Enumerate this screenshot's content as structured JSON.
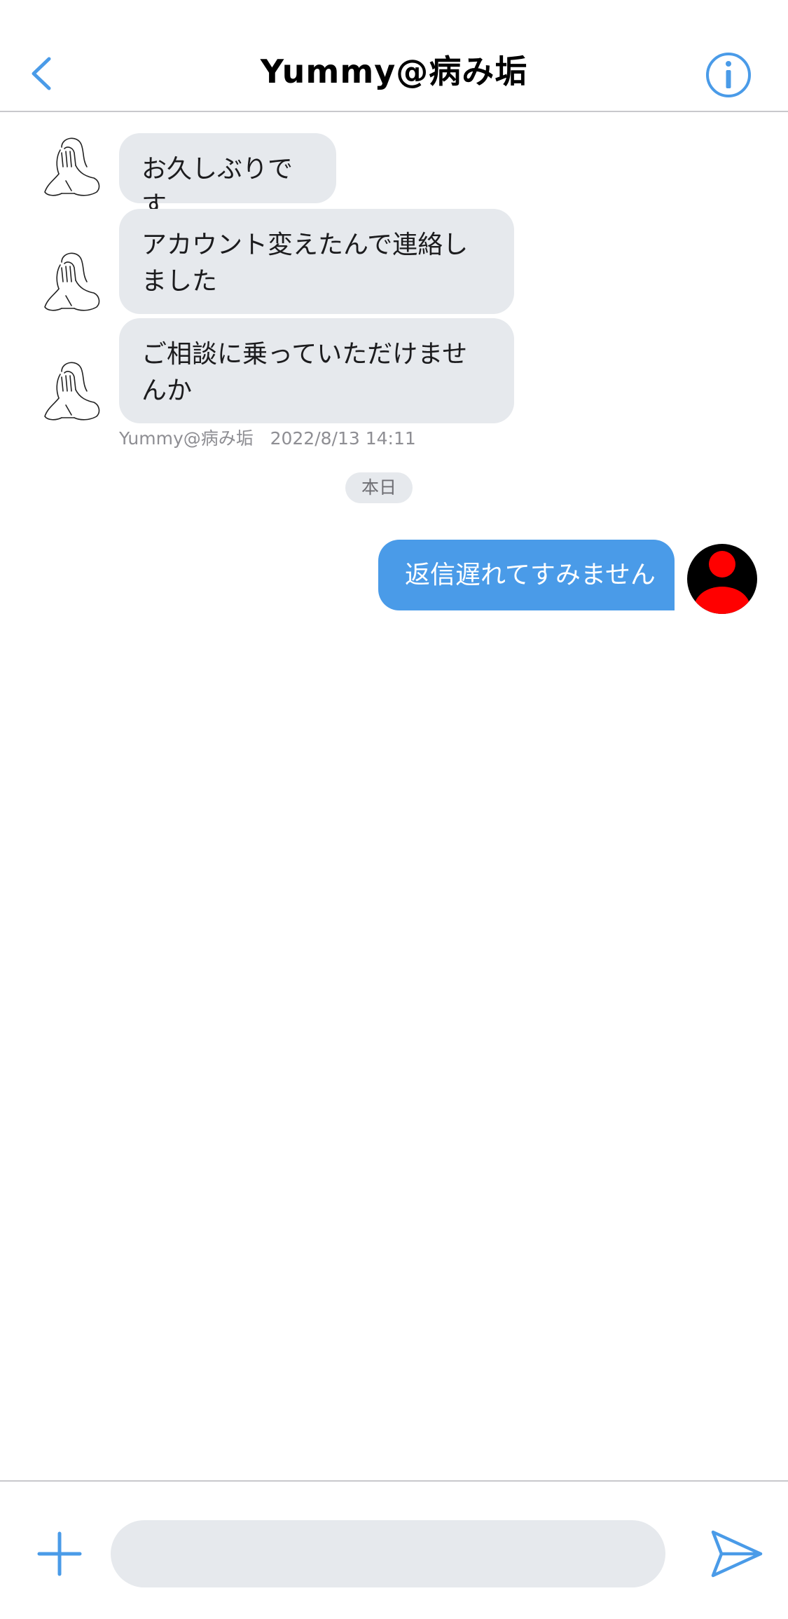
{
  "header": {
    "title": "Yummy@病み垢",
    "back_icon": "chevron-left-icon",
    "info_icon": "info-icon"
  },
  "messages_in": [
    {
      "text": "お久しぶりです"
    },
    {
      "text": "アカウント変えたんで連絡しました"
    },
    {
      "text": "ご相談に乗っていただけませんか"
    }
  ],
  "meta": {
    "sender": "Yummy@病み垢",
    "timestamp": "2022/8/13 14:11"
  },
  "day_separator": "本日",
  "messages_out": [
    {
      "text": "返信遅れてすみません"
    }
  ],
  "composer": {
    "placeholder": "",
    "plus_icon": "plus-icon",
    "send_icon": "send-icon"
  },
  "colors": {
    "accent": "#4a9be8",
    "bubble_in": "#e6e9ed",
    "avatar_out_bg": "#000000",
    "avatar_out_figure": "#ff0000"
  }
}
